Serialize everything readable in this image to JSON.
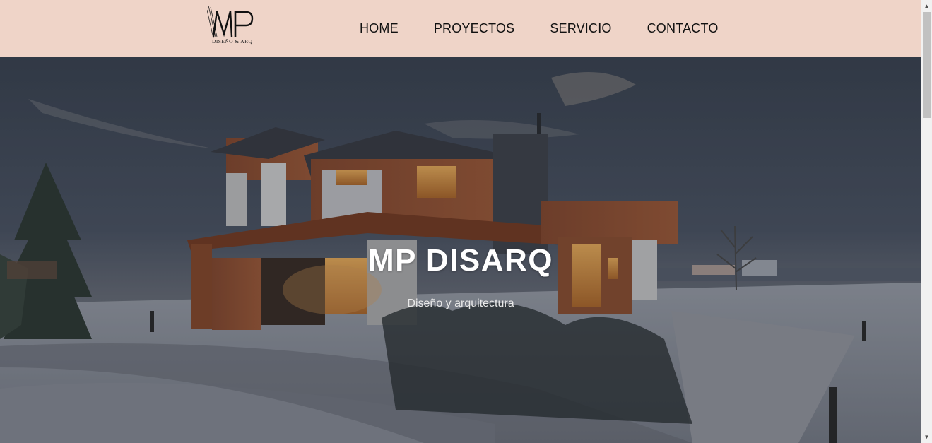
{
  "header": {
    "logo": {
      "mark": "MP",
      "subtitle": "DISEÑO & ARQ"
    },
    "nav": [
      {
        "label": "HOME"
      },
      {
        "label": "PROYECTOS"
      },
      {
        "label": "SERVICIO"
      },
      {
        "label": "CONTACTO"
      }
    ]
  },
  "hero": {
    "title": "MP DISARQ",
    "subtitle": "Diseño y arquitectura",
    "image_icon": "house-photo"
  },
  "scrollbar": {
    "up_icon": "triangle-up-icon",
    "down_icon": "triangle-down-icon",
    "position": 0.0
  },
  "colors": {
    "header_bg": "#efd4c8",
    "nav_text": "#111111",
    "hero_text": "#ffffff"
  }
}
